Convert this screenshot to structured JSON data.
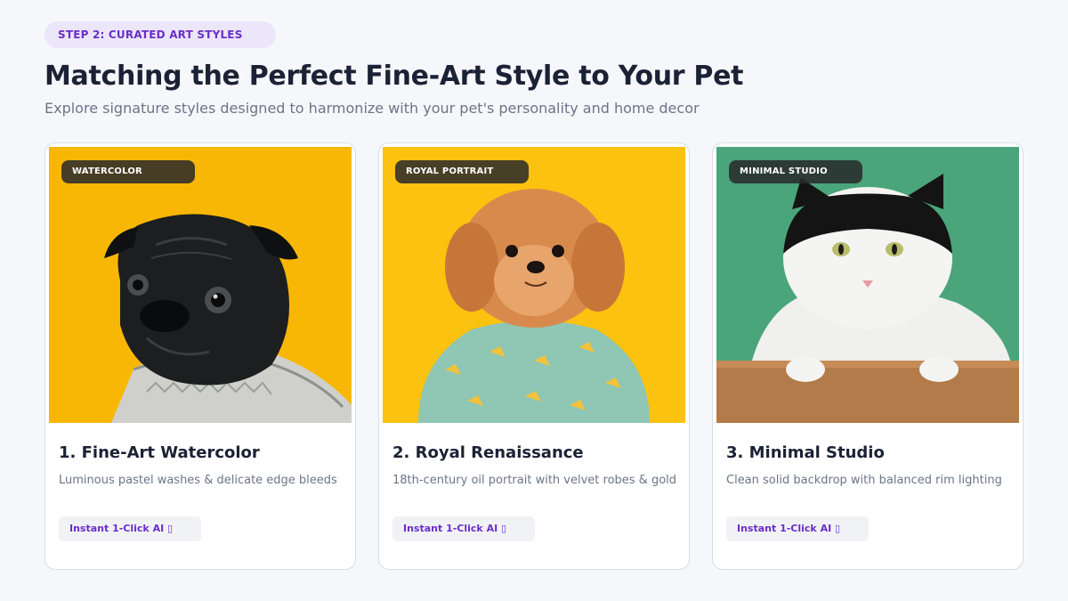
{
  "header": {
    "step_label": "STEP 2: CURATED ART STYLES",
    "title": "Matching the Perfect Fine-Art Style to Your Pet",
    "subtitle": "Explore signature styles designed to harmonize with your pet's personality and home decor"
  },
  "cards": [
    {
      "badge": "WATERCOLOR",
      "title": "1. Fine-Art Watercolor",
      "description": "Luminous pastel washes & delicate edge bleeds",
      "action_label": "Instant 1-Click AI ▯",
      "image_subject": "black pug in knit sweater on yellow background",
      "background_color": "#f9b705"
    },
    {
      "badge": "ROYAL PORTRAIT",
      "title": "2. Royal Renaissance",
      "description": "18th-century oil portrait with velvet robes & gold",
      "action_label": "Instant 1-Click AI ▯",
      "image_subject": "fluffy tan puppy in banana-print shirt on yellow background",
      "background_color": "#fbc20f"
    },
    {
      "badge": "MINIMAL STUDIO",
      "title": "3. Minimal Studio",
      "description": "Clean solid backdrop with balanced rim lighting",
      "action_label": "Instant 1-Click AI ▯",
      "image_subject": "black and white cat leaning on wooden table with green background",
      "background_color": "#4aa57a"
    }
  ]
}
